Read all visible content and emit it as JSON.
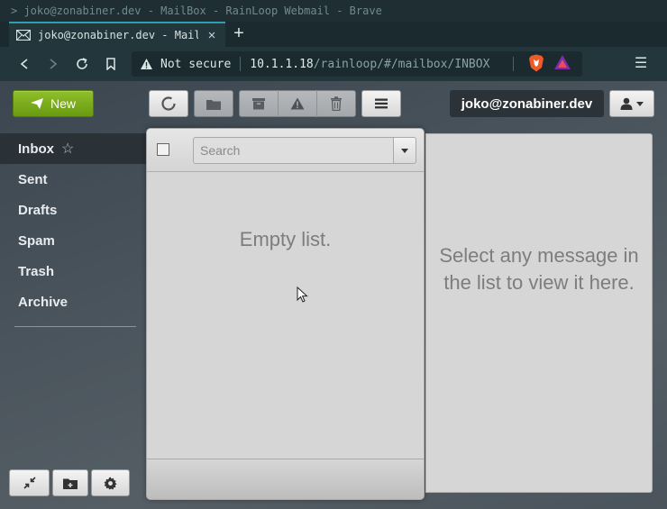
{
  "window": {
    "title": "> joko@zonabiner.dev - MailBox - RainLoop Webmail - Brave"
  },
  "browser": {
    "tab_title": "joko@zonabiner.dev - MailBox",
    "tab_close": "×",
    "new_tab": "+",
    "security_label": "Not secure",
    "url_host": "10.1.1.18",
    "url_path": "/rainloop/#/mailbox/INBOX",
    "menu_glyph": "☰"
  },
  "toolbar": {
    "new_label": "New",
    "user_email": "joko@zonabiner.dev"
  },
  "folders": [
    {
      "label": "Inbox",
      "active": true,
      "star": "☆"
    },
    {
      "label": "Sent"
    },
    {
      "label": "Drafts"
    },
    {
      "label": "Spam"
    },
    {
      "label": "Trash"
    },
    {
      "label": "Archive"
    }
  ],
  "message_list": {
    "search_placeholder": "Search",
    "empty_text": "Empty list."
  },
  "preview": {
    "placeholder_text": "Select any message in the list to view it here."
  },
  "colors": {
    "new_button": "#7aab1c",
    "tab_accent": "#2f9fb1",
    "user_badge": "#2b3338"
  }
}
